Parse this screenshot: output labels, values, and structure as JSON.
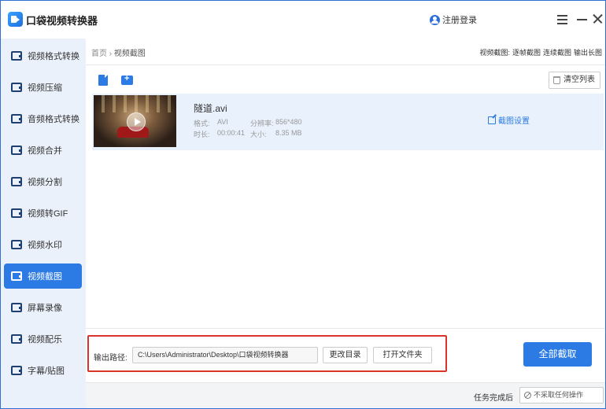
{
  "app": {
    "title": "口袋视频转换器",
    "login": "注册登录"
  },
  "sidebar": {
    "items": [
      {
        "label": "视频格式转换",
        "active": false
      },
      {
        "label": "视频压缩",
        "active": false
      },
      {
        "label": "音频格式转换",
        "active": false
      },
      {
        "label": "视频合并",
        "active": false
      },
      {
        "label": "视频分割",
        "active": false
      },
      {
        "label": "视频转GIF",
        "active": false
      },
      {
        "label": "视频水印",
        "active": false
      },
      {
        "label": "视频截图",
        "active": true
      },
      {
        "label": "屏幕录像",
        "active": false
      },
      {
        "label": "视频配乐",
        "active": false
      },
      {
        "label": "字幕/贴图",
        "active": false
      }
    ]
  },
  "breadcrumb": {
    "home": "首页",
    "separator": "›",
    "current": "视频截图"
  },
  "modes": {
    "label": "视频截图:",
    "options": [
      "逐帧截图",
      "连续截图",
      "输出长图"
    ]
  },
  "toolbar": {
    "clear": "清空列表"
  },
  "file": {
    "name": "隧道.avi",
    "format_label": "格式:",
    "format": "AVI",
    "resolution_label": "分辨率:",
    "resolution": "856*480",
    "duration_label": "时长:",
    "duration": "00:00:41",
    "size_label": "大小:",
    "size": "8.35 MB",
    "settings": "截图设置"
  },
  "output": {
    "label": "输出路径:",
    "path": "C:\\Users\\Administrator\\Desktop\\口袋视频转换器",
    "change_dir": "更改目录",
    "open_folder": "打开文件夹",
    "capture_all": "全部截取"
  },
  "footer": {
    "after_label": "任务完成后",
    "after_value": "不采取任何操作"
  },
  "colors": {
    "accent": "#2c7be5",
    "sidebar_bg": "#eaf1fb",
    "highlight": "#d9342b"
  }
}
